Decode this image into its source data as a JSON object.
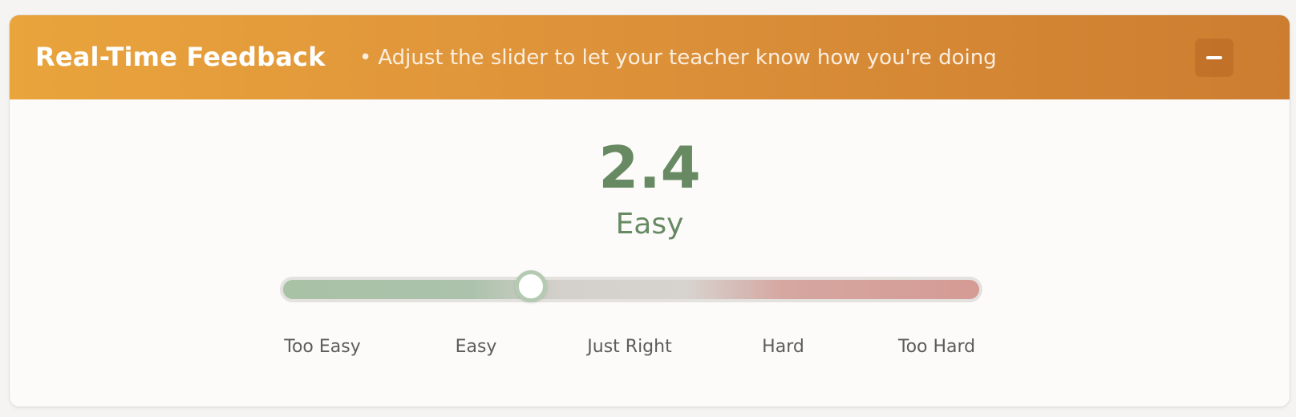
{
  "panel": {
    "title": "Real-Time Feedback",
    "subtitle_bullet": "•",
    "subtitle": "Adjust the slider to let your teacher know how you're doing",
    "collapse_icon": "minus-icon"
  },
  "feedback": {
    "value": "2.4",
    "level": "Easy"
  },
  "slider": {
    "min": 1,
    "max": 5,
    "value": 2.4,
    "labels": [
      "Too Easy",
      "Easy",
      "Just Right",
      "Hard",
      "Too Hard"
    ]
  },
  "colors": {
    "header_start": "#e9a43c",
    "header_end": "#cd7d30",
    "value_text": "#688a63",
    "easy_green": "#a8c2a6",
    "neutral": "#d7d3cf",
    "hard_red": "#d59b95"
  }
}
